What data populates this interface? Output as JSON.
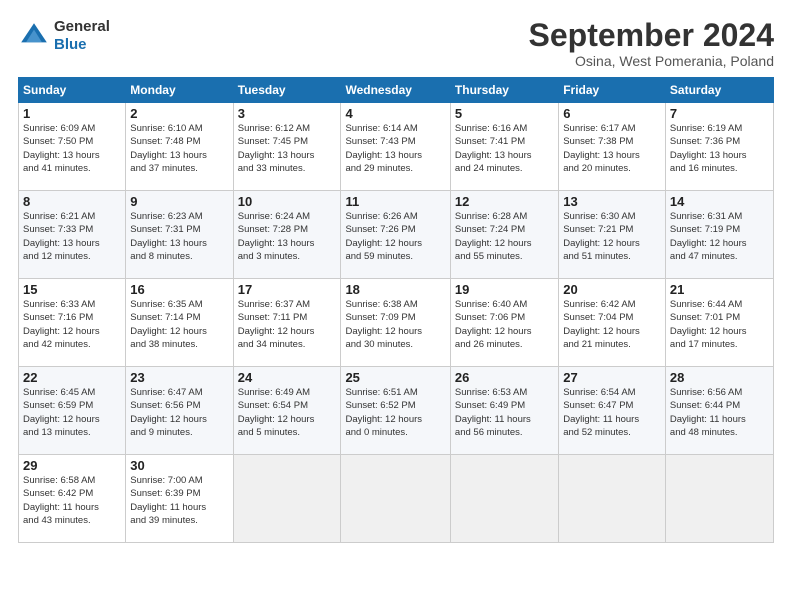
{
  "logo": {
    "line1": "General",
    "line2": "Blue"
  },
  "title": "September 2024",
  "location": "Osina, West Pomerania, Poland",
  "weekdays": [
    "Sunday",
    "Monday",
    "Tuesday",
    "Wednesday",
    "Thursday",
    "Friday",
    "Saturday"
  ],
  "weeks": [
    [
      {
        "day": "1",
        "info": "Sunrise: 6:09 AM\nSunset: 7:50 PM\nDaylight: 13 hours\nand 41 minutes."
      },
      {
        "day": "2",
        "info": "Sunrise: 6:10 AM\nSunset: 7:48 PM\nDaylight: 13 hours\nand 37 minutes."
      },
      {
        "day": "3",
        "info": "Sunrise: 6:12 AM\nSunset: 7:45 PM\nDaylight: 13 hours\nand 33 minutes."
      },
      {
        "day": "4",
        "info": "Sunrise: 6:14 AM\nSunset: 7:43 PM\nDaylight: 13 hours\nand 29 minutes."
      },
      {
        "day": "5",
        "info": "Sunrise: 6:16 AM\nSunset: 7:41 PM\nDaylight: 13 hours\nand 24 minutes."
      },
      {
        "day": "6",
        "info": "Sunrise: 6:17 AM\nSunset: 7:38 PM\nDaylight: 13 hours\nand 20 minutes."
      },
      {
        "day": "7",
        "info": "Sunrise: 6:19 AM\nSunset: 7:36 PM\nDaylight: 13 hours\nand 16 minutes."
      }
    ],
    [
      {
        "day": "8",
        "info": "Sunrise: 6:21 AM\nSunset: 7:33 PM\nDaylight: 13 hours\nand 12 minutes."
      },
      {
        "day": "9",
        "info": "Sunrise: 6:23 AM\nSunset: 7:31 PM\nDaylight: 13 hours\nand 8 minutes."
      },
      {
        "day": "10",
        "info": "Sunrise: 6:24 AM\nSunset: 7:28 PM\nDaylight: 13 hours\nand 3 minutes."
      },
      {
        "day": "11",
        "info": "Sunrise: 6:26 AM\nSunset: 7:26 PM\nDaylight: 12 hours\nand 59 minutes."
      },
      {
        "day": "12",
        "info": "Sunrise: 6:28 AM\nSunset: 7:24 PM\nDaylight: 12 hours\nand 55 minutes."
      },
      {
        "day": "13",
        "info": "Sunrise: 6:30 AM\nSunset: 7:21 PM\nDaylight: 12 hours\nand 51 minutes."
      },
      {
        "day": "14",
        "info": "Sunrise: 6:31 AM\nSunset: 7:19 PM\nDaylight: 12 hours\nand 47 minutes."
      }
    ],
    [
      {
        "day": "15",
        "info": "Sunrise: 6:33 AM\nSunset: 7:16 PM\nDaylight: 12 hours\nand 42 minutes."
      },
      {
        "day": "16",
        "info": "Sunrise: 6:35 AM\nSunset: 7:14 PM\nDaylight: 12 hours\nand 38 minutes."
      },
      {
        "day": "17",
        "info": "Sunrise: 6:37 AM\nSunset: 7:11 PM\nDaylight: 12 hours\nand 34 minutes."
      },
      {
        "day": "18",
        "info": "Sunrise: 6:38 AM\nSunset: 7:09 PM\nDaylight: 12 hours\nand 30 minutes."
      },
      {
        "day": "19",
        "info": "Sunrise: 6:40 AM\nSunset: 7:06 PM\nDaylight: 12 hours\nand 26 minutes."
      },
      {
        "day": "20",
        "info": "Sunrise: 6:42 AM\nSunset: 7:04 PM\nDaylight: 12 hours\nand 21 minutes."
      },
      {
        "day": "21",
        "info": "Sunrise: 6:44 AM\nSunset: 7:01 PM\nDaylight: 12 hours\nand 17 minutes."
      }
    ],
    [
      {
        "day": "22",
        "info": "Sunrise: 6:45 AM\nSunset: 6:59 PM\nDaylight: 12 hours\nand 13 minutes."
      },
      {
        "day": "23",
        "info": "Sunrise: 6:47 AM\nSunset: 6:56 PM\nDaylight: 12 hours\nand 9 minutes."
      },
      {
        "day": "24",
        "info": "Sunrise: 6:49 AM\nSunset: 6:54 PM\nDaylight: 12 hours\nand 5 minutes."
      },
      {
        "day": "25",
        "info": "Sunrise: 6:51 AM\nSunset: 6:52 PM\nDaylight: 12 hours\nand 0 minutes."
      },
      {
        "day": "26",
        "info": "Sunrise: 6:53 AM\nSunset: 6:49 PM\nDaylight: 11 hours\nand 56 minutes."
      },
      {
        "day": "27",
        "info": "Sunrise: 6:54 AM\nSunset: 6:47 PM\nDaylight: 11 hours\nand 52 minutes."
      },
      {
        "day": "28",
        "info": "Sunrise: 6:56 AM\nSunset: 6:44 PM\nDaylight: 11 hours\nand 48 minutes."
      }
    ],
    [
      {
        "day": "29",
        "info": "Sunrise: 6:58 AM\nSunset: 6:42 PM\nDaylight: 11 hours\nand 43 minutes."
      },
      {
        "day": "30",
        "info": "Sunrise: 7:00 AM\nSunset: 6:39 PM\nDaylight: 11 hours\nand 39 minutes."
      },
      null,
      null,
      null,
      null,
      null
    ]
  ]
}
